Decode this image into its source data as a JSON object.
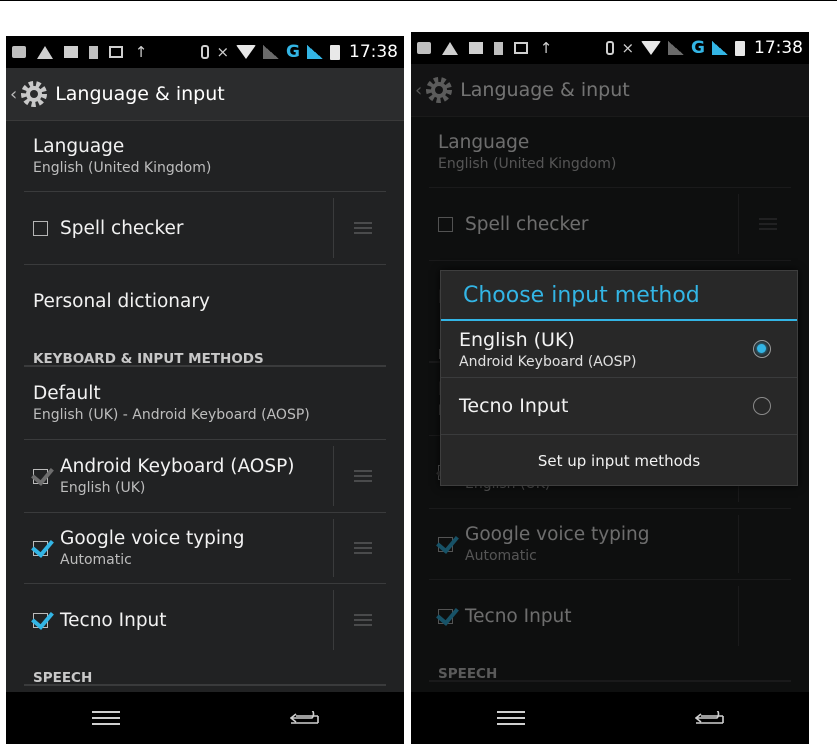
{
  "status_bar": {
    "time": "17:38",
    "network_type": "G"
  },
  "action_bar": {
    "title": "Language & input"
  },
  "settings": {
    "language": {
      "label": "Language",
      "value": "English (United Kingdom)"
    },
    "spell_checker": {
      "label": "Spell checker",
      "checked": false
    },
    "personal_dictionary": {
      "label": "Personal dictionary"
    },
    "keyboard_section": "KEYBOARD & INPUT METHODS",
    "default": {
      "label": "Default",
      "value": "English (UK) - Android Keyboard (AOSP)"
    },
    "android_keyboard": {
      "label": "Android Keyboard (AOSP)",
      "value": "English (UK)",
      "checked": true,
      "disabled": true
    },
    "google_voice": {
      "label": "Google voice typing",
      "value": "Automatic",
      "checked": true
    },
    "tecno_input": {
      "label": "Tecno Input",
      "checked": true
    },
    "speech_section": "SPEECH"
  },
  "dialog": {
    "title": "Choose input method",
    "options": [
      {
        "label": "English (UK)",
        "sub": "Android Keyboard (AOSP)",
        "selected": true
      },
      {
        "label": "Tecno Input",
        "sub": "",
        "selected": false
      }
    ],
    "setup_button": "Set up input methods"
  },
  "colors": {
    "accent": "#33b5e5",
    "background": "#212223",
    "statusbar": "#000000"
  }
}
